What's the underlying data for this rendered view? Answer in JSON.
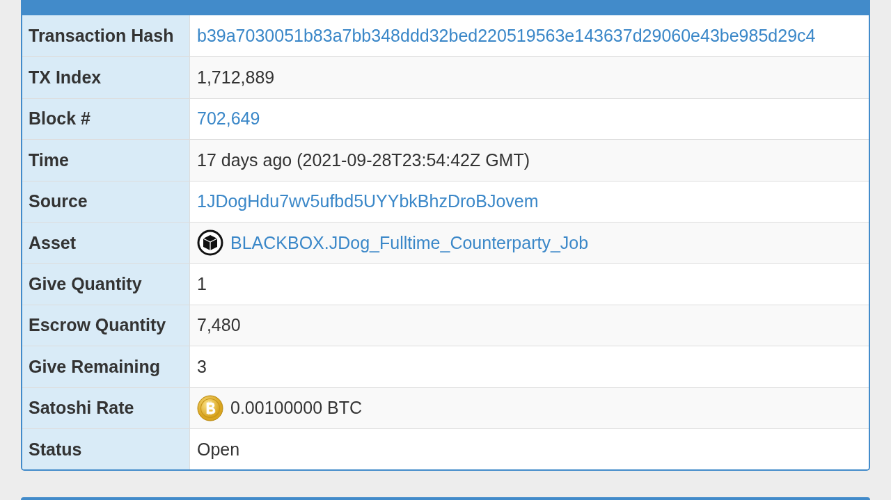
{
  "rows": [
    {
      "label": "Transaction Hash",
      "kind": "link",
      "value": "b39a7030051b83a7bb348ddd32bed220519563e143637d29060e43be985d29c4"
    },
    {
      "label": "TX Index",
      "kind": "text",
      "value": "1,712,889"
    },
    {
      "label": "Block #",
      "kind": "link",
      "value": "702,649"
    },
    {
      "label": "Time",
      "kind": "text",
      "value": "17 days ago (2021-09-28T23:54:42Z GMT)"
    },
    {
      "label": "Source",
      "kind": "link",
      "value": "1JDogHdu7wv5ufbd5UYYbkBhzDroBJovem"
    },
    {
      "label": "Asset",
      "kind": "asset",
      "value": "BLACKBOX.JDog_Fulltime_Counterparty_Job"
    },
    {
      "label": "Give Quantity",
      "kind": "text",
      "value": "1"
    },
    {
      "label": "Escrow Quantity",
      "kind": "text",
      "value": "7,480"
    },
    {
      "label": "Give Remaining",
      "kind": "text",
      "value": "3"
    },
    {
      "label": "Satoshi Rate",
      "kind": "btc",
      "value": "0.00100000 BTC"
    },
    {
      "label": "Status",
      "kind": "text",
      "value": "Open"
    }
  ]
}
